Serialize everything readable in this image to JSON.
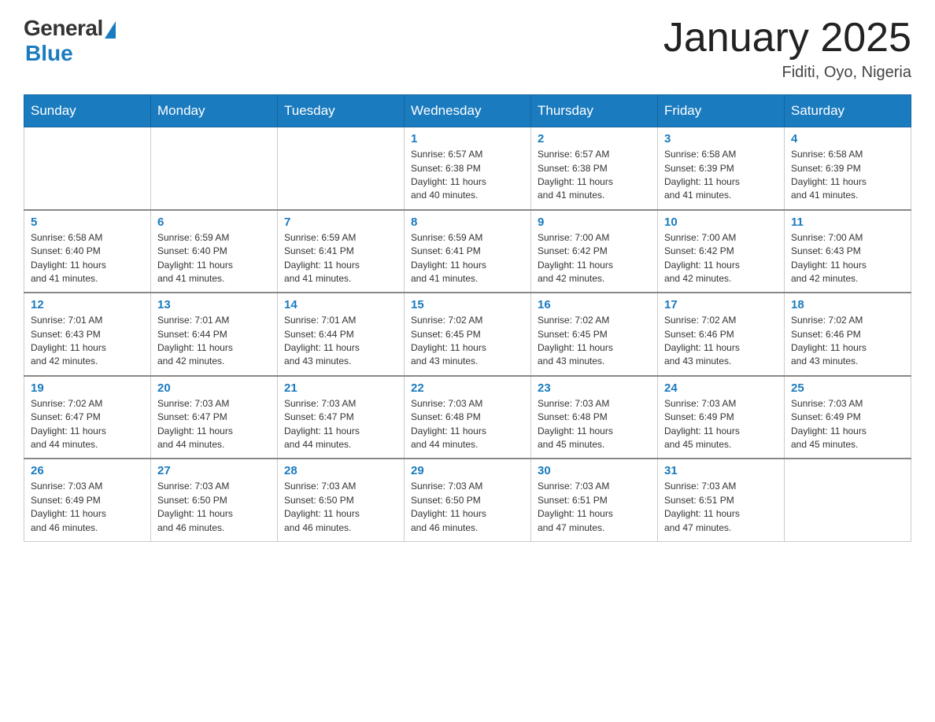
{
  "logo": {
    "general": "General",
    "blue": "Blue"
  },
  "title": "January 2025",
  "subtitle": "Fiditi, Oyo, Nigeria",
  "days_header": [
    "Sunday",
    "Monday",
    "Tuesday",
    "Wednesday",
    "Thursday",
    "Friday",
    "Saturday"
  ],
  "weeks": [
    [
      {
        "day": "",
        "info": ""
      },
      {
        "day": "",
        "info": ""
      },
      {
        "day": "",
        "info": ""
      },
      {
        "day": "1",
        "info": "Sunrise: 6:57 AM\nSunset: 6:38 PM\nDaylight: 11 hours\nand 40 minutes."
      },
      {
        "day": "2",
        "info": "Sunrise: 6:57 AM\nSunset: 6:38 PM\nDaylight: 11 hours\nand 41 minutes."
      },
      {
        "day": "3",
        "info": "Sunrise: 6:58 AM\nSunset: 6:39 PM\nDaylight: 11 hours\nand 41 minutes."
      },
      {
        "day": "4",
        "info": "Sunrise: 6:58 AM\nSunset: 6:39 PM\nDaylight: 11 hours\nand 41 minutes."
      }
    ],
    [
      {
        "day": "5",
        "info": "Sunrise: 6:58 AM\nSunset: 6:40 PM\nDaylight: 11 hours\nand 41 minutes."
      },
      {
        "day": "6",
        "info": "Sunrise: 6:59 AM\nSunset: 6:40 PM\nDaylight: 11 hours\nand 41 minutes."
      },
      {
        "day": "7",
        "info": "Sunrise: 6:59 AM\nSunset: 6:41 PM\nDaylight: 11 hours\nand 41 minutes."
      },
      {
        "day": "8",
        "info": "Sunrise: 6:59 AM\nSunset: 6:41 PM\nDaylight: 11 hours\nand 41 minutes."
      },
      {
        "day": "9",
        "info": "Sunrise: 7:00 AM\nSunset: 6:42 PM\nDaylight: 11 hours\nand 42 minutes."
      },
      {
        "day": "10",
        "info": "Sunrise: 7:00 AM\nSunset: 6:42 PM\nDaylight: 11 hours\nand 42 minutes."
      },
      {
        "day": "11",
        "info": "Sunrise: 7:00 AM\nSunset: 6:43 PM\nDaylight: 11 hours\nand 42 minutes."
      }
    ],
    [
      {
        "day": "12",
        "info": "Sunrise: 7:01 AM\nSunset: 6:43 PM\nDaylight: 11 hours\nand 42 minutes."
      },
      {
        "day": "13",
        "info": "Sunrise: 7:01 AM\nSunset: 6:44 PM\nDaylight: 11 hours\nand 42 minutes."
      },
      {
        "day": "14",
        "info": "Sunrise: 7:01 AM\nSunset: 6:44 PM\nDaylight: 11 hours\nand 43 minutes."
      },
      {
        "day": "15",
        "info": "Sunrise: 7:02 AM\nSunset: 6:45 PM\nDaylight: 11 hours\nand 43 minutes."
      },
      {
        "day": "16",
        "info": "Sunrise: 7:02 AM\nSunset: 6:45 PM\nDaylight: 11 hours\nand 43 minutes."
      },
      {
        "day": "17",
        "info": "Sunrise: 7:02 AM\nSunset: 6:46 PM\nDaylight: 11 hours\nand 43 minutes."
      },
      {
        "day": "18",
        "info": "Sunrise: 7:02 AM\nSunset: 6:46 PM\nDaylight: 11 hours\nand 43 minutes."
      }
    ],
    [
      {
        "day": "19",
        "info": "Sunrise: 7:02 AM\nSunset: 6:47 PM\nDaylight: 11 hours\nand 44 minutes."
      },
      {
        "day": "20",
        "info": "Sunrise: 7:03 AM\nSunset: 6:47 PM\nDaylight: 11 hours\nand 44 minutes."
      },
      {
        "day": "21",
        "info": "Sunrise: 7:03 AM\nSunset: 6:47 PM\nDaylight: 11 hours\nand 44 minutes."
      },
      {
        "day": "22",
        "info": "Sunrise: 7:03 AM\nSunset: 6:48 PM\nDaylight: 11 hours\nand 44 minutes."
      },
      {
        "day": "23",
        "info": "Sunrise: 7:03 AM\nSunset: 6:48 PM\nDaylight: 11 hours\nand 45 minutes."
      },
      {
        "day": "24",
        "info": "Sunrise: 7:03 AM\nSunset: 6:49 PM\nDaylight: 11 hours\nand 45 minutes."
      },
      {
        "day": "25",
        "info": "Sunrise: 7:03 AM\nSunset: 6:49 PM\nDaylight: 11 hours\nand 45 minutes."
      }
    ],
    [
      {
        "day": "26",
        "info": "Sunrise: 7:03 AM\nSunset: 6:49 PM\nDaylight: 11 hours\nand 46 minutes."
      },
      {
        "day": "27",
        "info": "Sunrise: 7:03 AM\nSunset: 6:50 PM\nDaylight: 11 hours\nand 46 minutes."
      },
      {
        "day": "28",
        "info": "Sunrise: 7:03 AM\nSunset: 6:50 PM\nDaylight: 11 hours\nand 46 minutes."
      },
      {
        "day": "29",
        "info": "Sunrise: 7:03 AM\nSunset: 6:50 PM\nDaylight: 11 hours\nand 46 minutes."
      },
      {
        "day": "30",
        "info": "Sunrise: 7:03 AM\nSunset: 6:51 PM\nDaylight: 11 hours\nand 47 minutes."
      },
      {
        "day": "31",
        "info": "Sunrise: 7:03 AM\nSunset: 6:51 PM\nDaylight: 11 hours\nand 47 minutes."
      },
      {
        "day": "",
        "info": ""
      }
    ]
  ]
}
